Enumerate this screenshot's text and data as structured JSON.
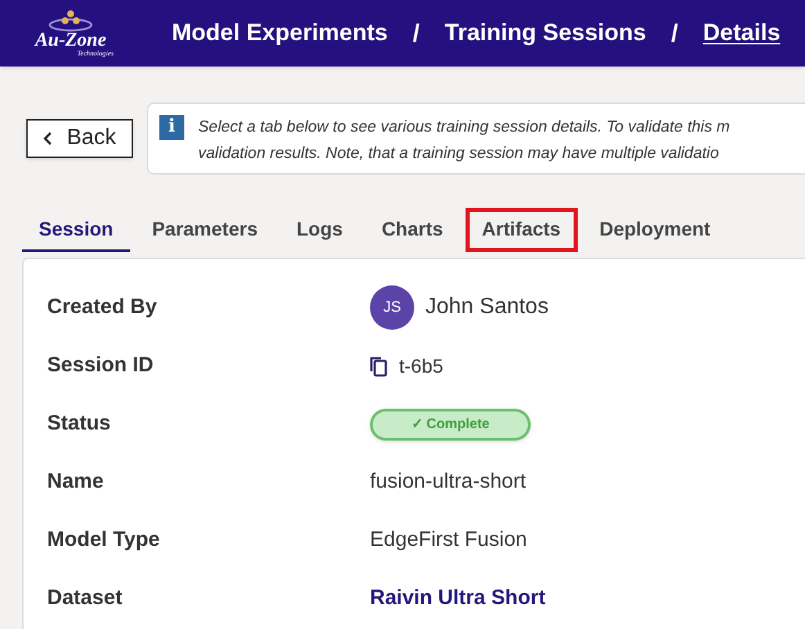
{
  "header": {
    "logo": {
      "name": "Au-Zone",
      "tagline": "Technologies"
    },
    "breadcrumbs": [
      {
        "label": "Model Experiments",
        "current": false
      },
      {
        "label": "Training Sessions",
        "current": false
      },
      {
        "label": "Details",
        "current": true
      }
    ],
    "separator": "/"
  },
  "back_button": {
    "label": "Back"
  },
  "info": {
    "icon": "i",
    "lines": [
      "Select a tab below to see various training session details. To validate this m",
      "validation results. Note, that a training session may have multiple validatio"
    ]
  },
  "tabs": [
    {
      "label": "Session",
      "selected": true,
      "highlighted": false
    },
    {
      "label": "Parameters",
      "selected": false,
      "highlighted": false
    },
    {
      "label": "Logs",
      "selected": false,
      "highlighted": false
    },
    {
      "label": "Charts",
      "selected": false,
      "highlighted": false
    },
    {
      "label": "Artifacts",
      "selected": false,
      "highlighted": true
    },
    {
      "label": "Deployment",
      "selected": false,
      "highlighted": false
    }
  ],
  "fields": [
    {
      "label": "Created By",
      "kind": "user",
      "initials": "JS",
      "value": "John Santos"
    },
    {
      "label": "Session ID",
      "kind": "copy",
      "value": "t-6b5"
    },
    {
      "label": "Status",
      "kind": "status",
      "value": "✓ Complete"
    },
    {
      "label": "Name",
      "kind": "text",
      "value": "fusion-ultra-short"
    },
    {
      "label": "Model Type",
      "kind": "text",
      "value": "EdgeFirst Fusion"
    },
    {
      "label": "Dataset",
      "kind": "link",
      "value": "Raivin Ultra Short"
    }
  ]
}
